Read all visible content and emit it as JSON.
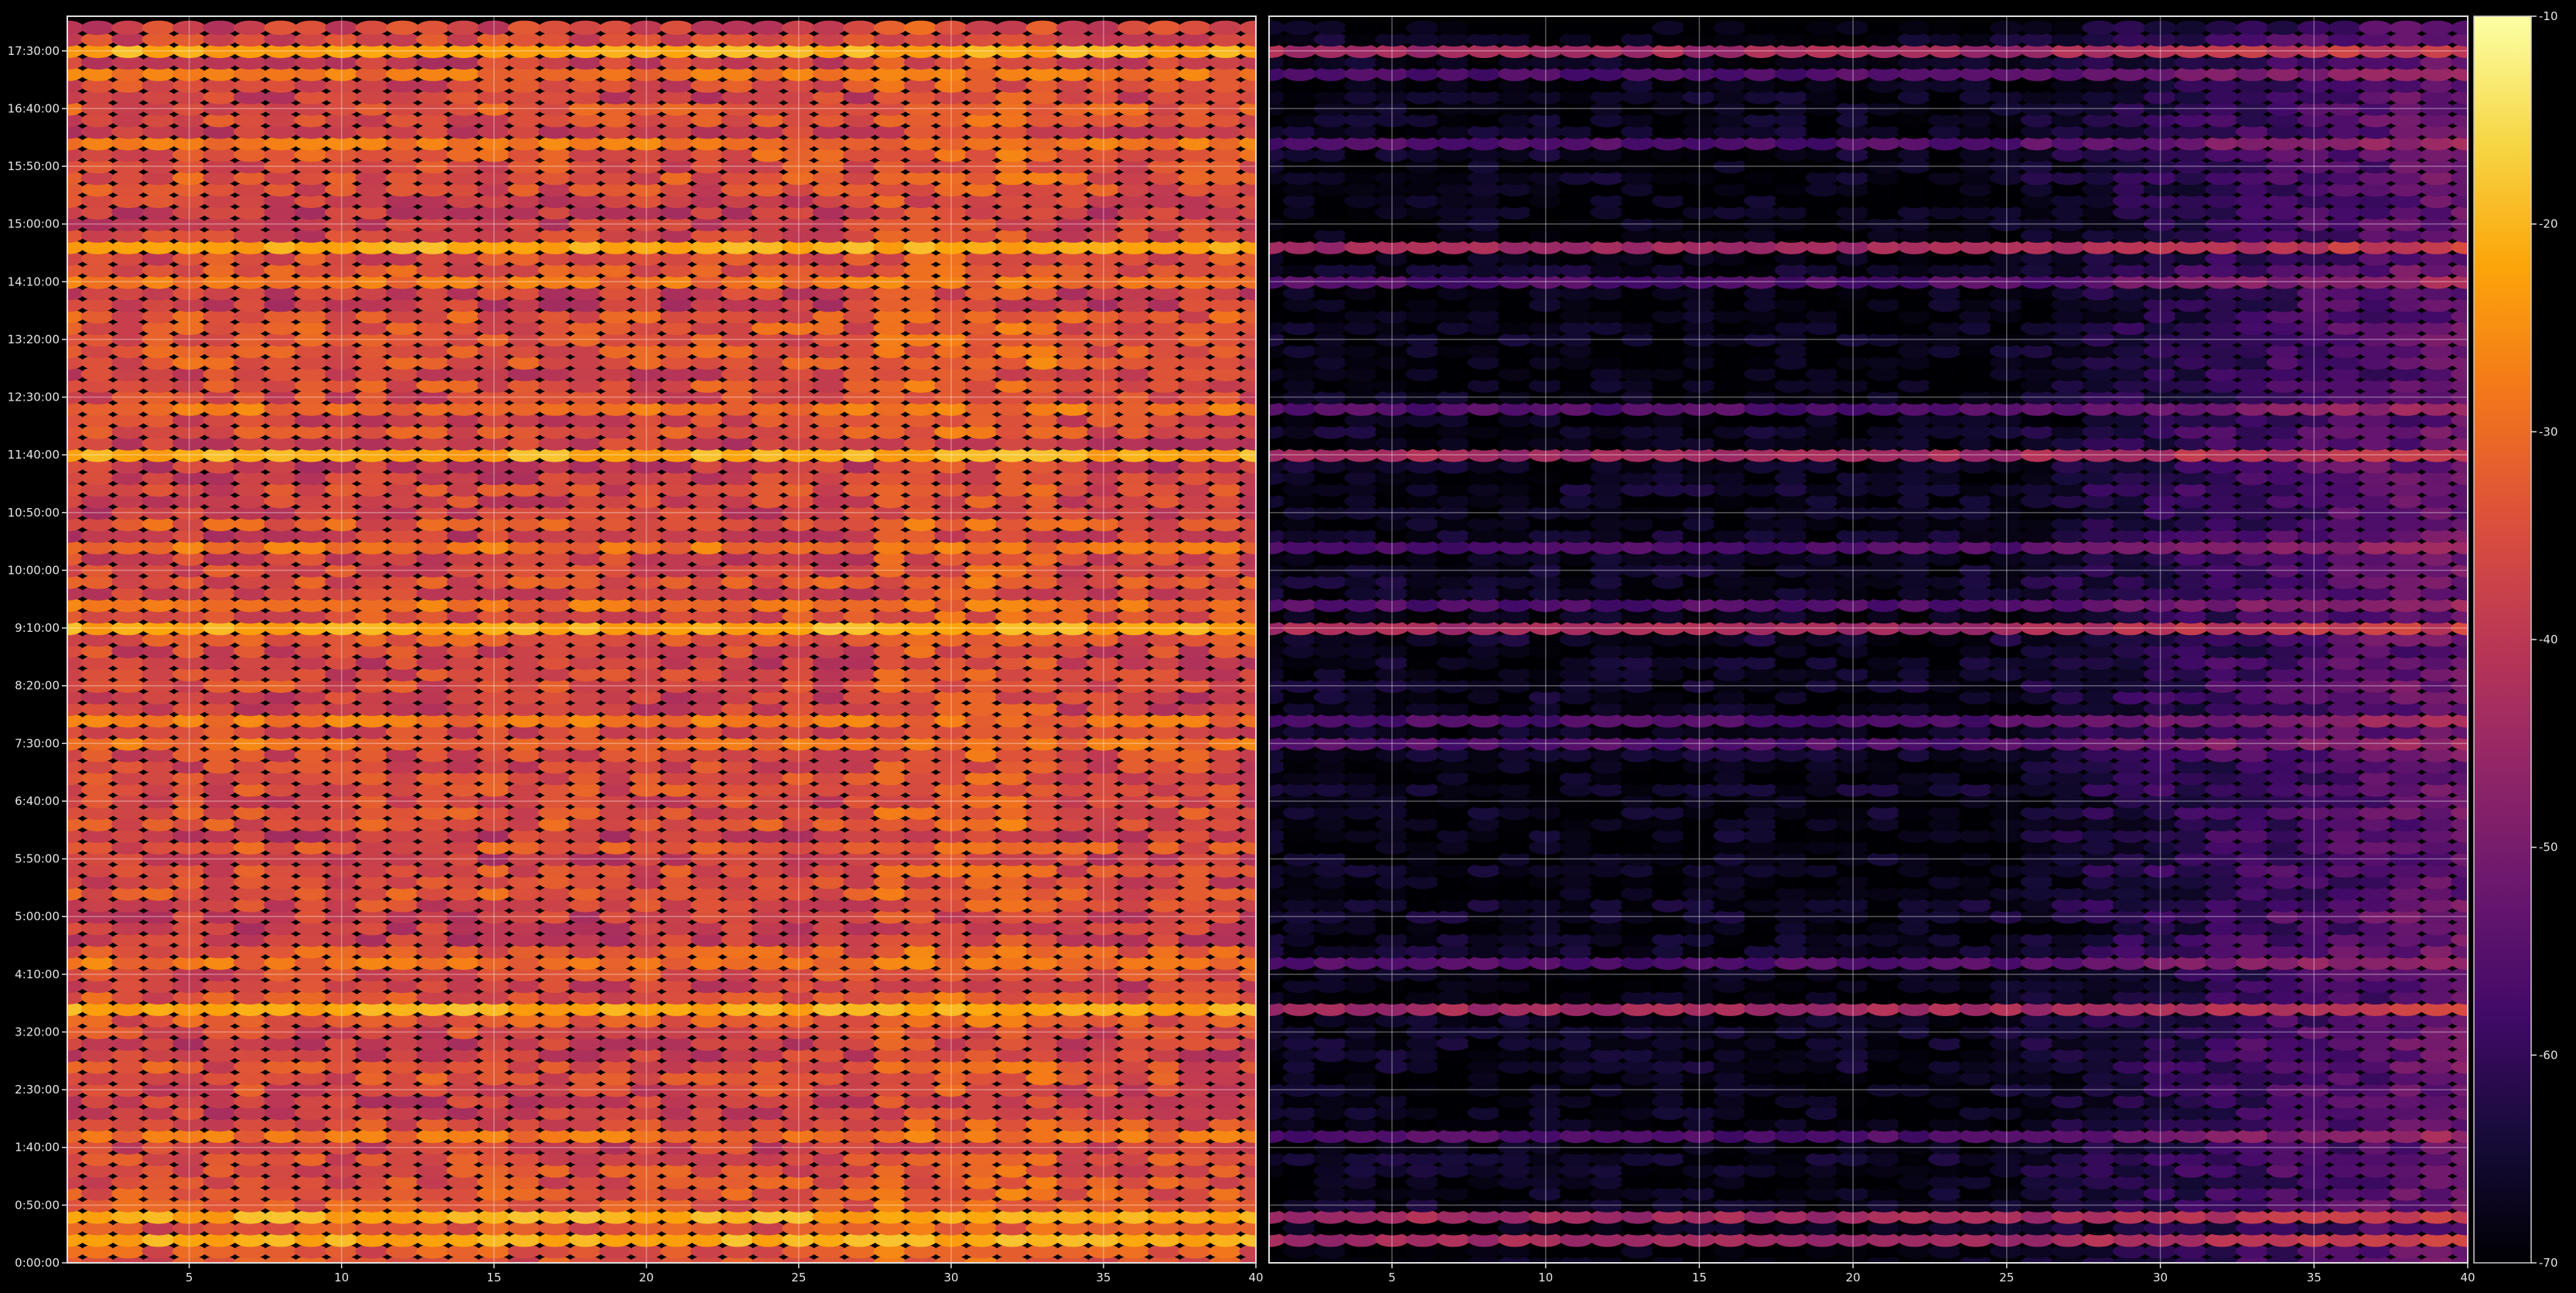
{
  "chart_data": {
    "type": "heatmap",
    "title": "",
    "xlabel": "",
    "ylabel": "",
    "colormap": "inferno",
    "panels": [
      {
        "name": "left",
        "xlim": [
          1,
          40
        ],
        "x_ticks": [
          "5",
          "10",
          "15",
          "20",
          "25",
          "30",
          "35",
          "40"
        ]
      },
      {
        "name": "right",
        "xlim": [
          1,
          40
        ],
        "x_ticks": [
          "5",
          "10",
          "15",
          "20",
          "25",
          "30",
          "35",
          "40"
        ]
      }
    ],
    "y_ticks": [
      "0:00:00",
      "0:50:00",
      "1:40:00",
      "2:30:00",
      "3:20:00",
      "4:10:00",
      "5:00:00",
      "5:50:00",
      "6:40:00",
      "7:30:00",
      "8:20:00",
      "9:10:00",
      "10:00:00",
      "10:50:00",
      "11:40:00",
      "12:30:00",
      "13:20:00",
      "14:10:00",
      "15:00:00",
      "15:50:00",
      "16:40:00",
      "17:30:00"
    ],
    "y_range": [
      "0:00:00",
      "17:50:00"
    ],
    "y_step_minutes": 10,
    "colorbar": {
      "min": -70,
      "max": -10,
      "ticks": [
        "-10",
        "-20",
        "-30",
        "-40",
        "-50",
        "-60",
        "-70"
      ]
    },
    "strong_rows": [
      "0:20:00",
      "0:40:00",
      "3:40:00",
      "9:10:00",
      "11:40:00",
      "14:40:00",
      "17:30:00"
    ],
    "medium_rows": [
      "1:50:00",
      "4:20:00",
      "7:30:00",
      "7:50:00",
      "9:30:00",
      "10:20:00",
      "12:20:00",
      "14:10:00",
      "16:10:00",
      "17:10:00"
    ],
    "summary": {
      "left_panel_mean_level": -36,
      "right_panel_mean_level": -62,
      "right_panel_background_level": -68,
      "right_panel_strong_row_level": -44
    },
    "grid": true,
    "legend": "colorbar-right"
  }
}
